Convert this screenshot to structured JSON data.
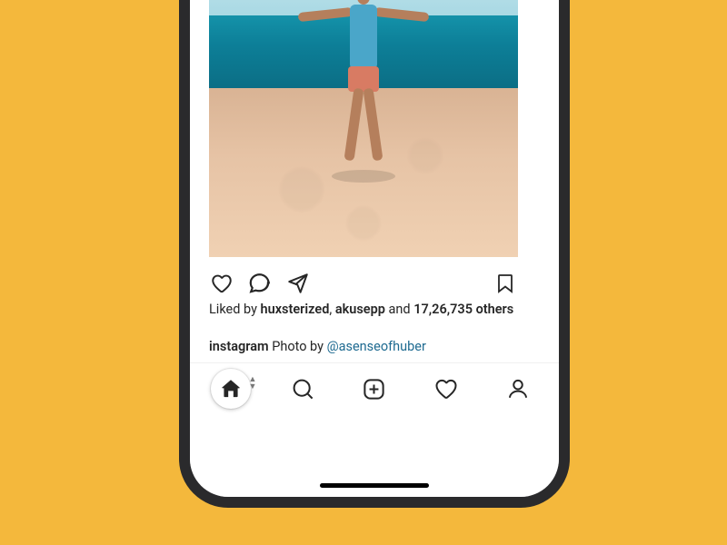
{
  "post": {
    "image_alt": "Person standing on a beach with arms outstretched facing the sea",
    "likes": {
      "prefix": "Liked by ",
      "user1": "huxsterized",
      "sep1": ", ",
      "user2": "akusepp",
      "sep2": " and ",
      "count": "17,26,735",
      "suffix": " others"
    },
    "caption": {
      "user": "instagram",
      "text_before": " Photo by ",
      "mention": "@asenseofhuber"
    }
  },
  "action_icons": {
    "like": "heart-icon",
    "comment": "comment-icon",
    "share": "send-icon",
    "save": "bookmark-icon"
  },
  "tabbar": {
    "home": "home-icon",
    "search": "search-icon",
    "create": "plus-icon",
    "activity": "heart-icon",
    "profile": "profile-icon"
  },
  "colors": {
    "background": "#f4b83c",
    "text": "#262626",
    "link": "#1f6b91"
  }
}
